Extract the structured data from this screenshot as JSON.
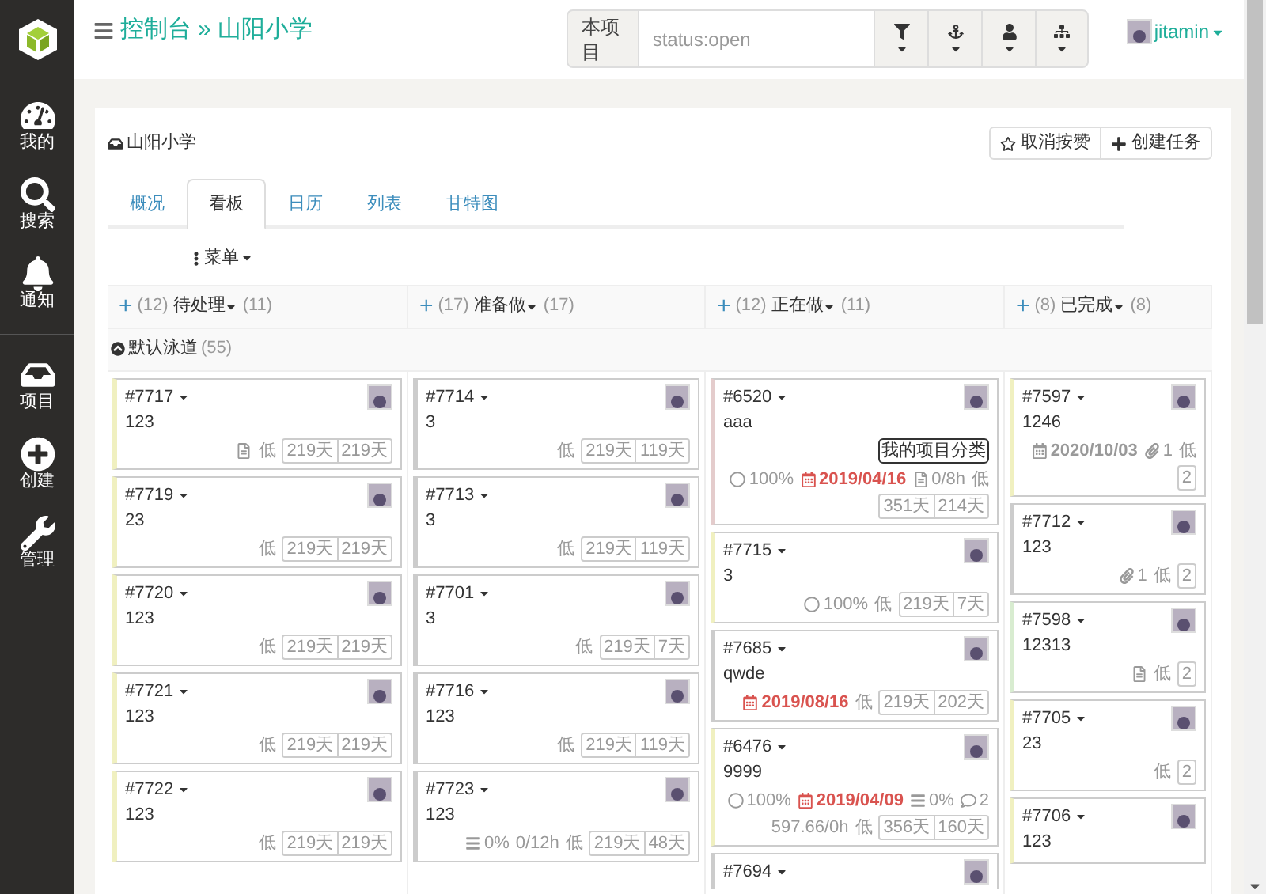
{
  "sidebar": {
    "items": [
      {
        "label": "我的"
      },
      {
        "label": "搜索"
      },
      {
        "label": "通知"
      }
    ],
    "project_items": [
      {
        "label": "项目"
      },
      {
        "label": "创建"
      },
      {
        "label": "管理"
      }
    ]
  },
  "topbar": {
    "breadcrumb": [
      "控制台",
      "»",
      "山阳小学"
    ],
    "search": {
      "scope": "本项目",
      "placeholder": "status:open"
    },
    "user": "jitamin"
  },
  "panel": {
    "title": "山阳小学",
    "buttons": [
      "取消按赞",
      "创建任务"
    ],
    "tabs": [
      {
        "label": "概况",
        "selected": false
      },
      {
        "label": "看板",
        "selected": true
      },
      {
        "label": "日历",
        "selected": false
      },
      {
        "label": "列表",
        "selected": false
      },
      {
        "label": "甘特图",
        "selected": false
      }
    ],
    "menu": "菜单"
  },
  "board": {
    "swimlane": {
      "title": "默认泳道",
      "count": "(55)"
    },
    "columns": [
      {
        "add": "+",
        "total": "(12)",
        "title": "待处理",
        "open": "(11)",
        "cards": [
          {
            "id": "#7717",
            "title": "123",
            "color": "#f0f0c0",
            "meta": [
              {
                "kind": "file"
              },
              {
                "kind": "priority",
                "text": "低"
              }
            ],
            "ages": [
              "219天",
              "219天"
            ]
          },
          {
            "id": "#7719",
            "title": "23",
            "color": "#f0f0c0",
            "meta": [
              {
                "kind": "priority",
                "text": "低"
              }
            ],
            "ages": [
              "219天",
              "219天"
            ]
          },
          {
            "id": "#7720",
            "title": "123",
            "color": "#f0f0c0",
            "meta": [
              {
                "kind": "priority",
                "text": "低"
              }
            ],
            "ages": [
              "219天",
              "219天"
            ]
          },
          {
            "id": "#7721",
            "title": "123",
            "color": "#f0f0c0",
            "meta": [
              {
                "kind": "priority",
                "text": "低"
              }
            ],
            "ages": [
              "219天",
              "219天"
            ]
          },
          {
            "id": "#7722",
            "title": "123",
            "color": "#f0f0c0",
            "meta": [
              {
                "kind": "priority",
                "text": "低"
              }
            ],
            "ages": [
              "219天",
              "219天"
            ]
          }
        ]
      },
      {
        "add": "+",
        "total": "(17)",
        "title": "准备做",
        "open": "(17)",
        "cards": [
          {
            "id": "#7714",
            "title": "3",
            "color": "#cccccc",
            "meta": [
              {
                "kind": "priority",
                "text": "低"
              }
            ],
            "ages": [
              "219天",
              "119天"
            ]
          },
          {
            "id": "#7713",
            "title": "3",
            "color": "#cccccc",
            "meta": [
              {
                "kind": "priority",
                "text": "低"
              }
            ],
            "ages": [
              "219天",
              "119天"
            ]
          },
          {
            "id": "#7701",
            "title": "3",
            "color": "#cccccc",
            "meta": [
              {
                "kind": "priority",
                "text": "低"
              }
            ],
            "ages": [
              "219天",
              "7天"
            ]
          },
          {
            "id": "#7716",
            "title": "123",
            "color": "#cccccc",
            "meta": [
              {
                "kind": "priority",
                "text": "低"
              }
            ],
            "ages": [
              "219天",
              "119天"
            ]
          },
          {
            "id": "#7723",
            "title": "123",
            "color": "#cccccc",
            "meta": [
              {
                "kind": "subtasks",
                "text": "0%"
              },
              {
                "kind": "text",
                "text": "0/12h"
              },
              {
                "kind": "priority",
                "text": "低"
              }
            ],
            "ages": [
              "219天",
              "48天"
            ]
          }
        ]
      },
      {
        "add": "+",
        "total": "(12)",
        "title": "正在做",
        "open": "(11)",
        "cards": [
          {
            "id": "#6520",
            "title": "aaa",
            "color": "#e4cccc",
            "tag": "我的项目分类",
            "meta": [
              {
                "kind": "progress",
                "text": "100%"
              },
              {
                "kind": "due",
                "text": "2019/04/16",
                "overdue": true
              },
              {
                "kind": "file",
                "text": "0/8h"
              },
              {
                "kind": "priority",
                "text": "低"
              }
            ],
            "ages": [
              "351天",
              "214天"
            ]
          },
          {
            "id": "#7715",
            "title": "3",
            "color": "#f0f0c0",
            "meta": [
              {
                "kind": "progress",
                "text": "100%"
              },
              {
                "kind": "priority",
                "text": "低"
              }
            ],
            "ages": [
              "219天",
              "7天"
            ]
          },
          {
            "id": "#7685",
            "title": "qwde",
            "color": "#cccccc",
            "meta": [
              {
                "kind": "due",
                "text": "2019/08/16",
                "overdue": true
              },
              {
                "kind": "priority",
                "text": "低"
              }
            ],
            "ages": [
              "219天",
              "202天"
            ]
          },
          {
            "id": "#6476",
            "title": "9999",
            "color": "#f0f0c0",
            "meta": [
              {
                "kind": "progress",
                "text": "100%"
              },
              {
                "kind": "due",
                "text": "2019/04/09",
                "overdue": true
              },
              {
                "kind": "subtasks",
                "text": "0%"
              },
              {
                "kind": "comments",
                "text": "2"
              },
              {
                "kind": "text",
                "text": "597.66/0h"
              },
              {
                "kind": "priority",
                "text": "低"
              }
            ],
            "ages": [
              "356天",
              "160天"
            ]
          },
          {
            "id": "#7694"
          }
        ]
      },
      {
        "add": "+",
        "total": "(8)",
        "title": "已完成",
        "open": "(8)",
        "cards": [
          {
            "id": "#7597",
            "title": "1246",
            "color": "#f0f0c0",
            "meta": [
              {
                "kind": "due",
                "text": "2020/10/03",
                "overdue": false
              },
              {
                "kind": "attachments",
                "text": "1"
              },
              {
                "kind": "priority",
                "text": "低"
              }
            ],
            "ages": [
              "2"
            ]
          },
          {
            "id": "#7712",
            "title": "123",
            "color": "#cccccc",
            "meta": [
              {
                "kind": "attachments",
                "text": "1"
              },
              {
                "kind": "priority",
                "text": "低"
              }
            ],
            "ages": [
              "2"
            ]
          },
          {
            "id": "#7598",
            "title": "12313",
            "color": "#d8ecd0",
            "meta": [
              {
                "kind": "file"
              },
              {
                "kind": "priority",
                "text": "低"
              }
            ],
            "ages": [
              "2"
            ]
          },
          {
            "id": "#7705",
            "title": "23",
            "color": "#f0f0c0",
            "meta": [
              {
                "kind": "priority",
                "text": "低"
              }
            ],
            "ages": [
              "2"
            ]
          },
          {
            "id": "#7706",
            "title": "123",
            "color": "#f0f0c0"
          }
        ]
      }
    ]
  }
}
